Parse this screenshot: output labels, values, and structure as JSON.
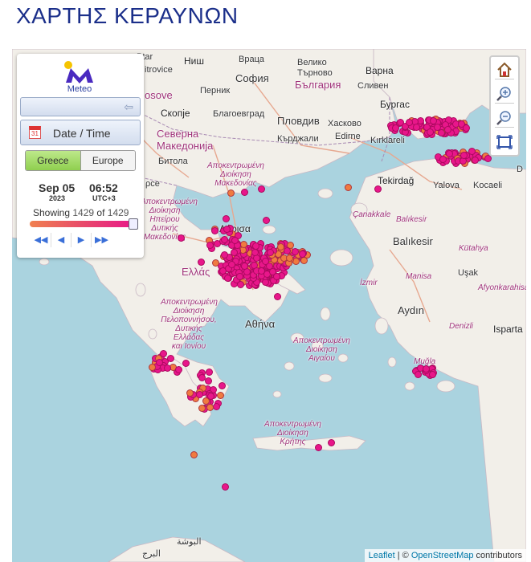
{
  "page": {
    "title": "ΧΑΡΤΗΣ ΚΕΡΑΥΝΩΝ"
  },
  "panel": {
    "logo_text": "Meteo",
    "date_button_label": "Date / Time",
    "calendar_day": "31",
    "region_options": [
      "Greece",
      "Europe"
    ],
    "selected_region": "Greece",
    "date": "Sep 05",
    "year": "2023",
    "time": "06:52",
    "timezone": "UTC+3",
    "showing_prefix": "Showing",
    "showing_count": "1429",
    "showing_of": "of",
    "showing_total": "1429",
    "slider_fraction": 1.0,
    "playback": {
      "first": "◀◀",
      "prev": "◀",
      "next": "▶",
      "last": "▶▶"
    }
  },
  "colors": {
    "title": "#1b2f8a",
    "strike_recent": "#e8168a",
    "strike_older": "#f07a40",
    "sea": "#aad3df",
    "land": "#f2efe9"
  },
  "icons": [
    "home-icon",
    "zoom-in-icon",
    "zoom-out-icon",
    "fullscreen-icon",
    "calendar-icon",
    "back-arrow-icon"
  ],
  "attribution": {
    "leaflet": "Leaflet",
    "separator": " | © ",
    "osm": "OpenStreetMap",
    "suffix": " contributors"
  },
  "labels": {
    "nis": "Ниш",
    "sofia": "София",
    "veliko": "Велико",
    "bulgaria": "България",
    "varna": "Варна",
    "sliven": "Сливен",
    "pernik": "Перник",
    "burgas": "Бургас",
    "skopje": "Скопје",
    "blagoevgrad": "Благоевград",
    "plovdiv": "Пловдив",
    "haskovo": "Хасково",
    "kardzhali": "Кърджали",
    "edirne": "Edirne",
    "kirklareli": "Kırklareli",
    "makedonija": "Северна\nМакедонија",
    "bitola": "Битола",
    "kosovo": "osove",
    "trovice": "itrovice",
    "tekirdag": "Tekirdağ",
    "yalova": "Yalova",
    "kocaeli": "Kocaeli",
    "canakkale": "Çanakkale",
    "balikesir": "Balıkesir",
    "balikesir2": "Balıkesir",
    "kutahya": "Kütahya",
    "manisa": "Manisa",
    "usak": "Uşak",
    "izmir": "İzmir",
    "afyon": "Afyonkarahisar",
    "aydin": "Aydın",
    "denizli": "Denizli",
    "isparta": "Isparta",
    "mugla": "Muğla",
    "larisa": "Λάρισα",
    "ellada": "Ελλάς",
    "athina": "Αθήνα",
    "reg_makedonia": "Αποκεντρωμένη\nΔιοίκηση\nΜακεδονίας",
    "reg_ipeirou": "Αποκεντρωμένη\nΔιοίκηση\nΗπείρου\nΔυτικής\nΜακεδονίας",
    "reg_pelopon": "Αποκεντρωμένη\nΔιοίκηση\nΠελοποννήσου,\nΔυτικής\nΕλλάδας\nκαι Ιονίου",
    "reg_aigaiou": "Αποκεντρωμένη\nΔιοίκηση\nΑιγαίου",
    "reg_kritis": "Αποκεντρωμένη\nΔιοίκηση\nΚρήτης",
    "lbl_eur": "ρce",
    "bousha": "البوشة",
    "borg": "البرج",
    "d": "D"
  }
}
